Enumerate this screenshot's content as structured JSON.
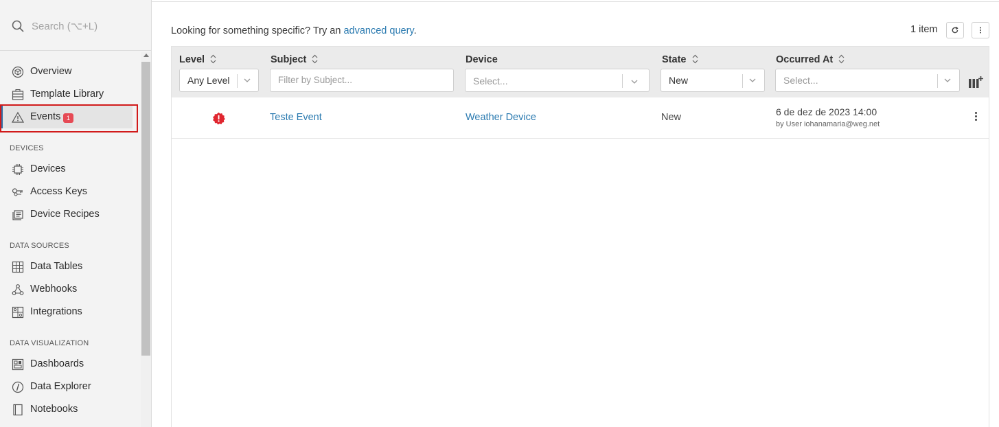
{
  "sidebar": {
    "search_placeholder": "Search (⌥+L)",
    "items": [
      {
        "label": "Overview"
      },
      {
        "label": "Template Library"
      },
      {
        "label": "Events",
        "badge": "1"
      }
    ],
    "sections": [
      {
        "title": "DEVICES",
        "items": [
          {
            "label": "Devices"
          },
          {
            "label": "Access Keys"
          },
          {
            "label": "Device Recipes"
          }
        ]
      },
      {
        "title": "DATA SOURCES",
        "items": [
          {
            "label": "Data Tables"
          },
          {
            "label": "Webhooks"
          },
          {
            "label": "Integrations"
          }
        ]
      },
      {
        "title": "DATA VISUALIZATION",
        "items": [
          {
            "label": "Dashboards"
          },
          {
            "label": "Data Explorer"
          },
          {
            "label": "Notebooks"
          }
        ]
      }
    ]
  },
  "main": {
    "hint_text": "Looking for something specific? Try an",
    "hint_link": "advanced query",
    "hint_end": ".",
    "item_count": "1 item",
    "columns": {
      "level": {
        "header": "Level",
        "filter_value": "Any Level"
      },
      "subject": {
        "header": "Subject",
        "filter_placeholder": "Filter by Subject..."
      },
      "device": {
        "header": "Device",
        "filter_placeholder": "Select..."
      },
      "state": {
        "header": "State",
        "filter_value": "New"
      },
      "occurred": {
        "header": "Occurred At",
        "filter_placeholder": "Select..."
      }
    },
    "rows": [
      {
        "level_icon": "error-icon",
        "subject": "Teste Event",
        "device": "Weather Device",
        "state": "New",
        "occurred": "6 de dez de 2023 14:00",
        "occurred_by": "by User iohanamaria@weg.net"
      }
    ]
  },
  "colors": {
    "accent": "#2a7ab0",
    "error": "#e0262f",
    "badge": "#e64a55",
    "highlight": "#d11a1a",
    "active_bar": "#2f6fa6"
  }
}
